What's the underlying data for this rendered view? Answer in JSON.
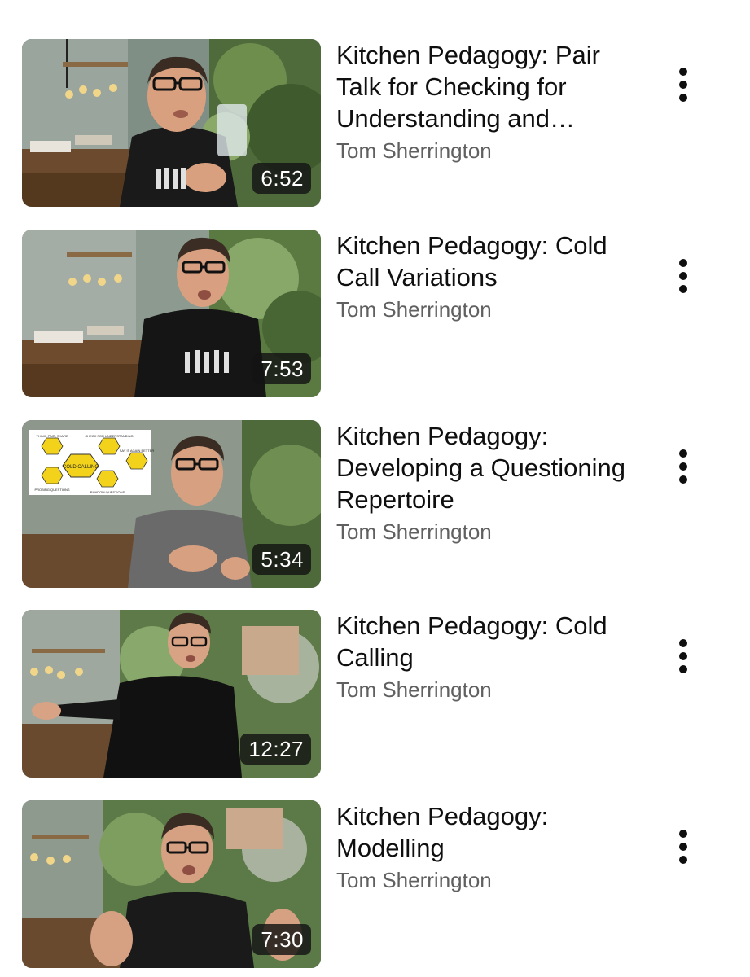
{
  "videos": [
    {
      "title": "Kitchen Pedagogy: Pair Talk for Checking for Understanding and Metacognition",
      "channel": "Tom Sherrington",
      "duration": "6:52",
      "menu_icon": "more-vert-icon"
    },
    {
      "title": "Kitchen Pedagogy: Cold Call Variations",
      "channel": "Tom Sherrington",
      "duration": "7:53",
      "menu_icon": "more-vert-icon"
    },
    {
      "title": "Kitchen Pedagogy: Developing a Questioning Repertoire",
      "channel": "Tom Sherrington",
      "duration": "5:34",
      "menu_icon": "more-vert-icon",
      "slide": {
        "center": "COLD CALLING",
        "tiles": [
          "THINK, PAIR, SHARE",
          "CHECK FOR UNDERSTANDING",
          "SAY IT AGAIN BETTER",
          "PROBING QUESTIONS",
          "RANDOM QUESTIONS"
        ]
      }
    },
    {
      "title": "Kitchen Pedagogy: Cold Calling",
      "channel": "Tom Sherrington",
      "duration": "12:27",
      "menu_icon": "more-vert-icon"
    },
    {
      "title": "Kitchen Pedagogy: Modelling",
      "channel": "Tom Sherrington",
      "duration": "7:30",
      "menu_icon": "more-vert-icon"
    }
  ],
  "colors": {
    "title": "#0f0f0f",
    "channel": "#606060",
    "duration_bg": "#141414",
    "slide_yellow": "#f2d21b"
  }
}
